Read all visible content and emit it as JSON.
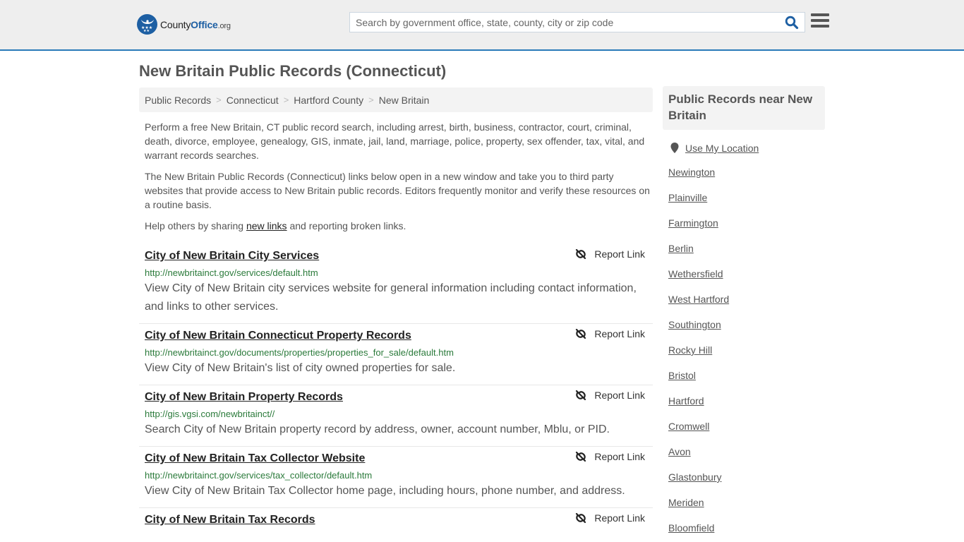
{
  "header": {
    "logo": {
      "name": "County",
      "office": "Office",
      "tld": ".org"
    },
    "search": {
      "placeholder": "Search by government office, state, county, city or zip code",
      "value": ""
    },
    "icons": {
      "search": "search-icon",
      "menu": "hamburger-menu-icon"
    }
  },
  "page": {
    "title": "New Britain Public Records (Connecticut)"
  },
  "breadcrumb": [
    {
      "label": "Public Records"
    },
    {
      "label": "Connecticut"
    },
    {
      "label": "Hartford County"
    },
    {
      "label": "New Britain"
    }
  ],
  "breadcrumb_separator": ">",
  "intro": {
    "p1": "Perform a free New Britain, CT public record search, including arrest, birth, business, contractor, court, criminal, death, divorce, employee, genealogy, GIS, inmate, jail, land, marriage, police, property, sex offender, tax, vital, and warrant records searches.",
    "p2": "The New Britain Public Records (Connecticut) links below open in a new window and take you to third party websites that provide access to New Britain public records. Editors frequently monitor and verify these resources on a routine basis.",
    "p3_before": "Help others by sharing ",
    "p3_link": "new links",
    "p3_after": " and reporting broken links."
  },
  "report_label": "Report Link",
  "records": [
    {
      "title": "City of New Britain City Services",
      "url": "http://newbritainct.gov/services/default.htm",
      "desc": "View City of New Britain city services website for general information including contact information, and links to other services."
    },
    {
      "title": "City of New Britain Connecticut Property Records",
      "url": "http://newbritainct.gov/documents/properties/properties_for_sale/default.htm",
      "desc": "View City of New Britain's list of city owned properties for sale."
    },
    {
      "title": "City of New Britain Property Records",
      "url": "http://gis.vgsi.com/newbritainct//",
      "desc": "Search City of New Britain property record by address, owner, account number, Mblu, or PID."
    },
    {
      "title": "City of New Britain Tax Collector Website",
      "url": "http://newbritainct.gov/services/tax_collector/default.htm",
      "desc": "View City of New Britain Tax Collector home page, including hours, phone number, and address."
    },
    {
      "title": "City of New Britain Tax Records",
      "url": "",
      "desc": ""
    }
  ],
  "sidebar": {
    "heading": "Public Records near New Britain",
    "use_location": "Use My Location",
    "nearby": [
      "Newington",
      "Plainville",
      "Farmington",
      "Berlin",
      "Wethersfield",
      "West Hartford",
      "Southington",
      "Rocky Hill",
      "Bristol",
      "Hartford",
      "Cromwell",
      "Avon",
      "Glastonbury",
      "Meriden",
      "Bloomfield"
    ]
  },
  "colors": {
    "accent_blue": "#2a7ab8",
    "logo_blue": "#1d5fa3",
    "url_green": "#2a7a3a",
    "header_bg": "#eeeeee",
    "panel_bg": "#f3f3f3"
  }
}
